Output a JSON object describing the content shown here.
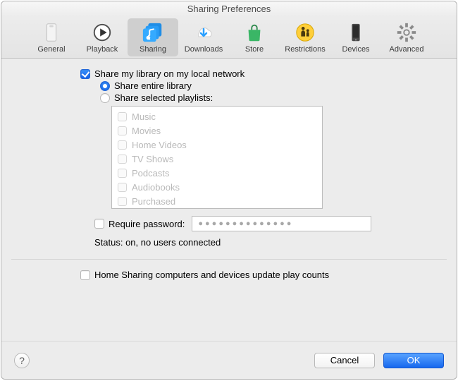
{
  "window": {
    "title": "Sharing Preferences"
  },
  "toolbar": {
    "items": [
      {
        "label": "General"
      },
      {
        "label": "Playback"
      },
      {
        "label": "Sharing"
      },
      {
        "label": "Downloads"
      },
      {
        "label": "Store"
      },
      {
        "label": "Restrictions"
      },
      {
        "label": "Devices"
      },
      {
        "label": "Advanced"
      }
    ],
    "selected_index": 2
  },
  "sharing": {
    "share_library_label": "Share my library on my local network",
    "share_library_checked": true,
    "share_entire_label": "Share entire library",
    "share_entire_selected": true,
    "share_selected_label": "Share selected playlists:",
    "share_selected_selected": false,
    "playlists": [
      "Music",
      "Movies",
      "Home Videos",
      "TV Shows",
      "Podcasts",
      "Audiobooks",
      "Purchased"
    ],
    "require_password_label": "Require password:",
    "require_password_checked": false,
    "password_dots": "●●●●●●●●●●●●●●",
    "status_label": "Status: on, no users connected"
  },
  "home_sharing": {
    "update_play_counts_label": "Home Sharing computers and devices update play counts",
    "update_play_counts_checked": false
  },
  "footer": {
    "help": "?",
    "cancel": "Cancel",
    "ok": "OK"
  },
  "colors": {
    "accent": "#1a6fe8"
  }
}
